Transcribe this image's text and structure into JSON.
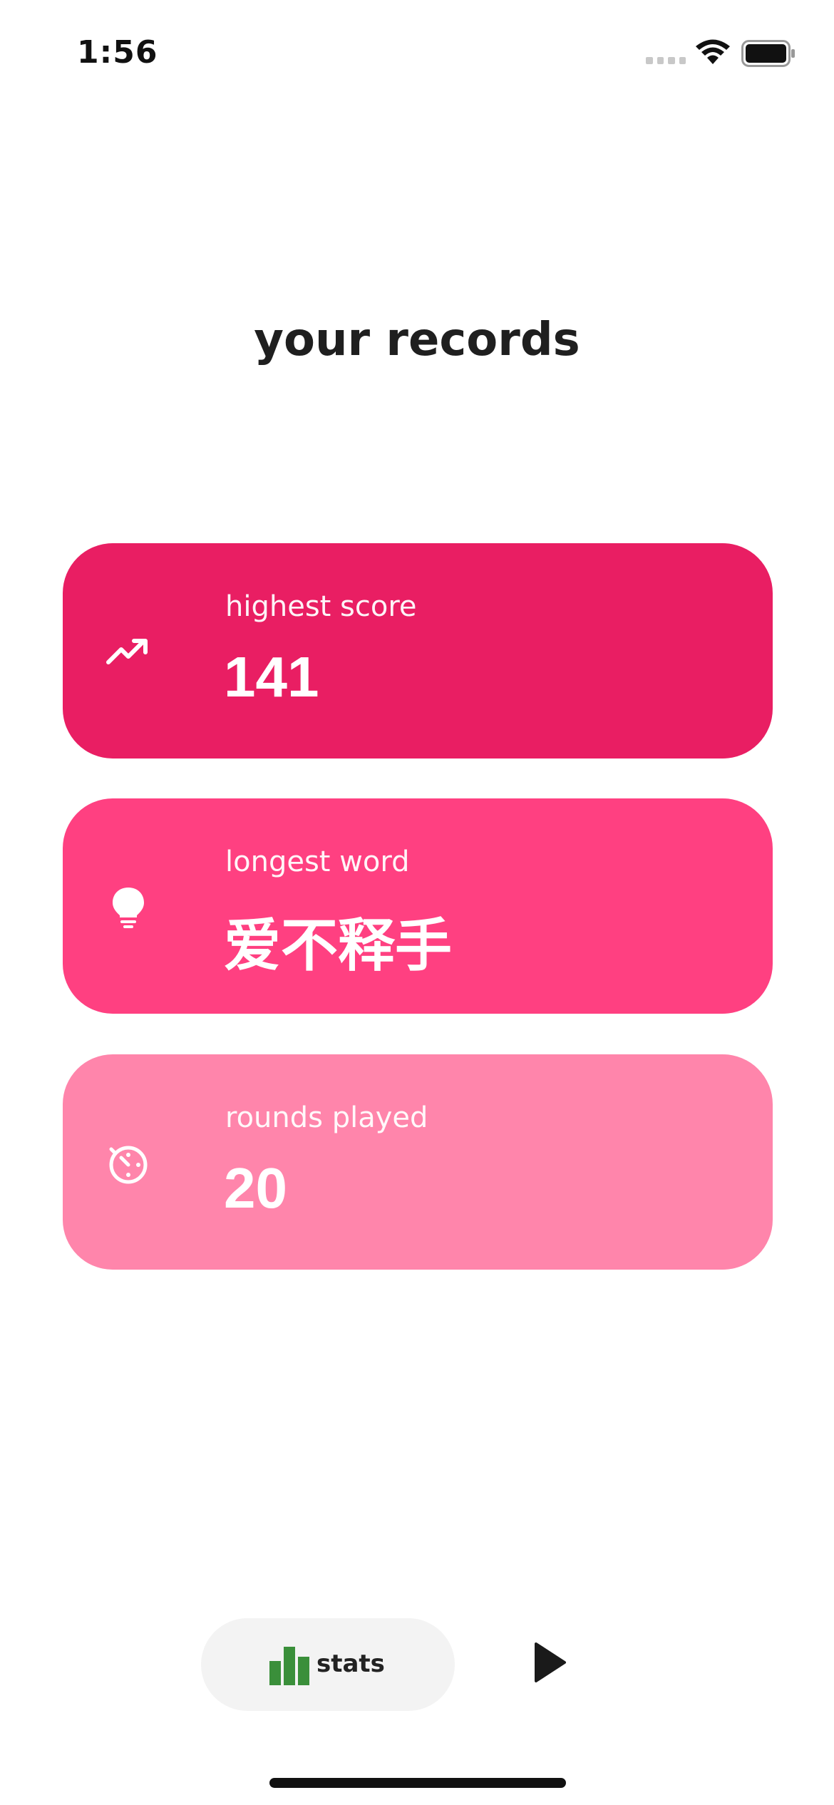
{
  "status_bar": {
    "time": "1:56"
  },
  "title": "your records",
  "colors": {
    "card_1": "#e91e63",
    "card_2": "#ff4081",
    "card_3": "#ff85ab",
    "stats_icon": "#3a8f3a"
  },
  "cards": [
    {
      "icon": "trending-up-icon",
      "label": "highest score",
      "value": "141"
    },
    {
      "icon": "lightbulb-icon",
      "label": "longest word",
      "value": "爱不释手"
    },
    {
      "icon": "timer-icon",
      "label": "rounds played",
      "value": "20"
    }
  ],
  "nav": {
    "stats_label": "stats",
    "stats_icon": "bar-chart-icon",
    "play_icon": "play-icon"
  }
}
